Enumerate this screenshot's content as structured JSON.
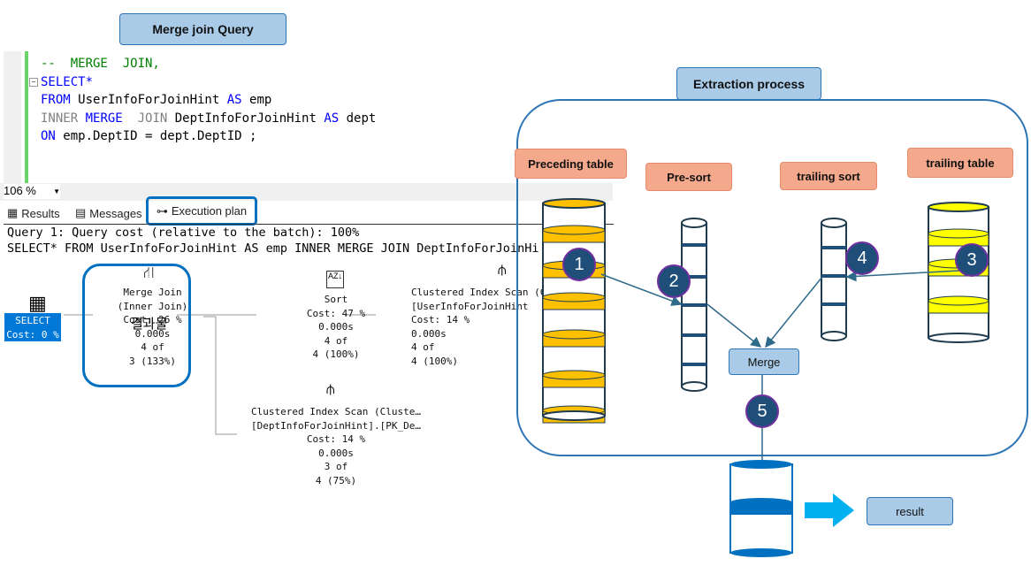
{
  "title": "Merge join Query",
  "editor": {
    "lines": [
      [
        {
          "t": "--  MERGE  JOIN,",
          "c": "cm"
        }
      ],
      [
        {
          "t": "SELECT*",
          "c": "kw"
        }
      ],
      [
        {
          "t": "FROM",
          "c": "kw"
        },
        {
          "t": " UserInfoForJoinHint ",
          "c": ""
        },
        {
          "t": "AS",
          "c": "kw"
        },
        {
          "t": " emp",
          "c": ""
        }
      ],
      [
        {
          "t": "INNER",
          "c": "gr"
        },
        {
          "t": " MERGE",
          "c": "kw"
        },
        {
          "t": "  JOIN",
          "c": "gr"
        },
        {
          "t": " DeptInfoForJoinHint ",
          "c": ""
        },
        {
          "t": "AS",
          "c": "kw"
        },
        {
          "t": " dept",
          "c": ""
        }
      ],
      [
        {
          "t": "ON",
          "c": "kw"
        },
        {
          "t": " emp.DeptID = dept.DeptID ;",
          "c": ""
        }
      ]
    ]
  },
  "zoom": "106 %",
  "tabs": {
    "results": "Results",
    "messages": "Messages",
    "plan": "Execution plan"
  },
  "plan": {
    "header1": "Query 1: Query cost (relative to the batch): 100%",
    "header2": "SELECT* FROM UserInfoForJoinHint AS emp INNER MERGE JOIN DeptInfoForJoinHi",
    "select": "SELECT\nCost: 0 %",
    "merge": "Merge Join\n(Inner Join)\nCost: 26 %\n0.000s\n4 of\n3 (133%)",
    "merge_overlay": "결과물",
    "sort": "Sort\nCost: 47 %\n0.000s\n4 of\n4 (100%)",
    "scan1": "Clustered Index Scan (Cluste…\n[UserInfoForJoinHint\nCost: 14 %\n0.000s\n4 of\n4 (100%)",
    "scan2": "Clustered Index Scan (Cluste…\n[DeptInfoForJoinHint].[PK_De…\nCost: 14 %\n0.000s\n3 of\n4 (75%)"
  },
  "diagram": {
    "title": "Extraction process",
    "preceding": "Preceding table",
    "presort": "Pre-sort",
    "trailing_sort": "trailing sort",
    "trailing": "trailing table",
    "merge": "Merge",
    "result": "result",
    "steps": [
      "1",
      "2",
      "3",
      "4",
      "5"
    ],
    "colors": {
      "orange": "#ffc000",
      "yellow": "#ffff00",
      "blue": "#0070c0",
      "step": "#1f4e79",
      "arrow": "#00b0f0"
    }
  }
}
